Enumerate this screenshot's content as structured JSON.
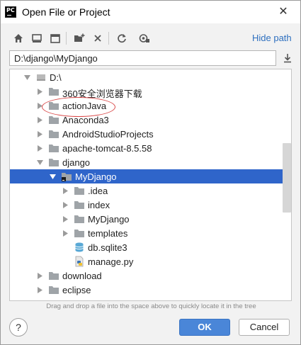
{
  "window": {
    "title": "Open File or Project",
    "app_icon": "pycharm-logo",
    "close_glyph": "✕"
  },
  "toolbar": {
    "buttons": [
      {
        "name": "home-icon",
        "tooltip": ""
      },
      {
        "name": "desktop-icon",
        "tooltip": ""
      },
      {
        "name": "project-icon",
        "tooltip": ""
      },
      {
        "name": "new-folder-icon",
        "tooltip": ""
      },
      {
        "name": "delete-icon",
        "tooltip": ""
      },
      {
        "name": "refresh-icon",
        "tooltip": ""
      },
      {
        "name": "show-hidden-icon",
        "tooltip": ""
      }
    ],
    "hide_path": "Hide path"
  },
  "path": {
    "value": "D:\\django\\MyDjango"
  },
  "tree": {
    "rows": [
      {
        "label": "D:\\",
        "depth": 0,
        "expanded": true,
        "type": "drive"
      },
      {
        "label": "360安全浏览器下载",
        "depth": 1,
        "expanded": false,
        "type": "folder"
      },
      {
        "label": "actionJava",
        "depth": 1,
        "expanded": false,
        "type": "folder"
      },
      {
        "label": "Anaconda3",
        "depth": 1,
        "expanded": false,
        "type": "folder"
      },
      {
        "label": "AndroidStudioProjects",
        "depth": 1,
        "expanded": false,
        "type": "folder"
      },
      {
        "label": "apache-tomcat-8.5.58",
        "depth": 1,
        "expanded": false,
        "type": "folder"
      },
      {
        "label": "django",
        "depth": 1,
        "expanded": true,
        "type": "folder"
      },
      {
        "label": "MyDjango",
        "depth": 2,
        "expanded": true,
        "type": "project-folder",
        "selected": true
      },
      {
        "label": ".idea",
        "depth": 3,
        "expanded": false,
        "type": "folder"
      },
      {
        "label": "index",
        "depth": 3,
        "expanded": false,
        "type": "folder"
      },
      {
        "label": "MyDjango",
        "depth": 3,
        "expanded": false,
        "type": "folder"
      },
      {
        "label": "templates",
        "depth": 3,
        "expanded": false,
        "type": "folder"
      },
      {
        "label": "db.sqlite3",
        "depth": 3,
        "type": "database"
      },
      {
        "label": "manage.py",
        "depth": 3,
        "type": "python"
      },
      {
        "label": "download",
        "depth": 1,
        "expanded": false,
        "type": "folder"
      },
      {
        "label": "eclipse",
        "depth": 1,
        "expanded": false,
        "type": "folder"
      }
    ]
  },
  "hint": "Drag and drop a file into the space above to quickly locate it in the tree",
  "footer": {
    "help": "?",
    "ok": "OK",
    "cancel": "Cancel"
  },
  "colors": {
    "selection": "#2f65ca",
    "ok_button": "#4a86d8",
    "link": "#2d6fbf",
    "highlight_ellipse": "#d94848"
  }
}
